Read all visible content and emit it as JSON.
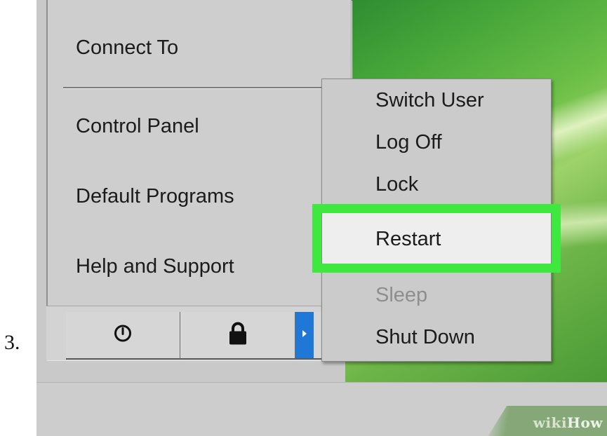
{
  "step_number": "3.",
  "start_menu": {
    "items": [
      {
        "label": "Connect To"
      },
      {
        "label": "Control Panel"
      },
      {
        "label": "Default Programs"
      },
      {
        "label": "Help and Support"
      }
    ]
  },
  "button_row": {
    "shutdown_icon": "power-icon",
    "lock_icon": "padlock-icon",
    "arrow_icon": "chevron-right-icon",
    "arrow_color": "#1f78d6"
  },
  "submenu": {
    "items": [
      {
        "label": "Switch User",
        "enabled": true
      },
      {
        "label": "Log Off",
        "enabled": true
      },
      {
        "label": "Lock",
        "enabled": true
      },
      {
        "label": "Restart",
        "enabled": true,
        "highlighted": true
      },
      {
        "label": "Sleep",
        "enabled": false
      },
      {
        "label": "Shut Down",
        "enabled": true
      }
    ],
    "highlight_color": "#3ee83e"
  },
  "watermark": {
    "prefix": "wiki",
    "suffix": "How"
  }
}
